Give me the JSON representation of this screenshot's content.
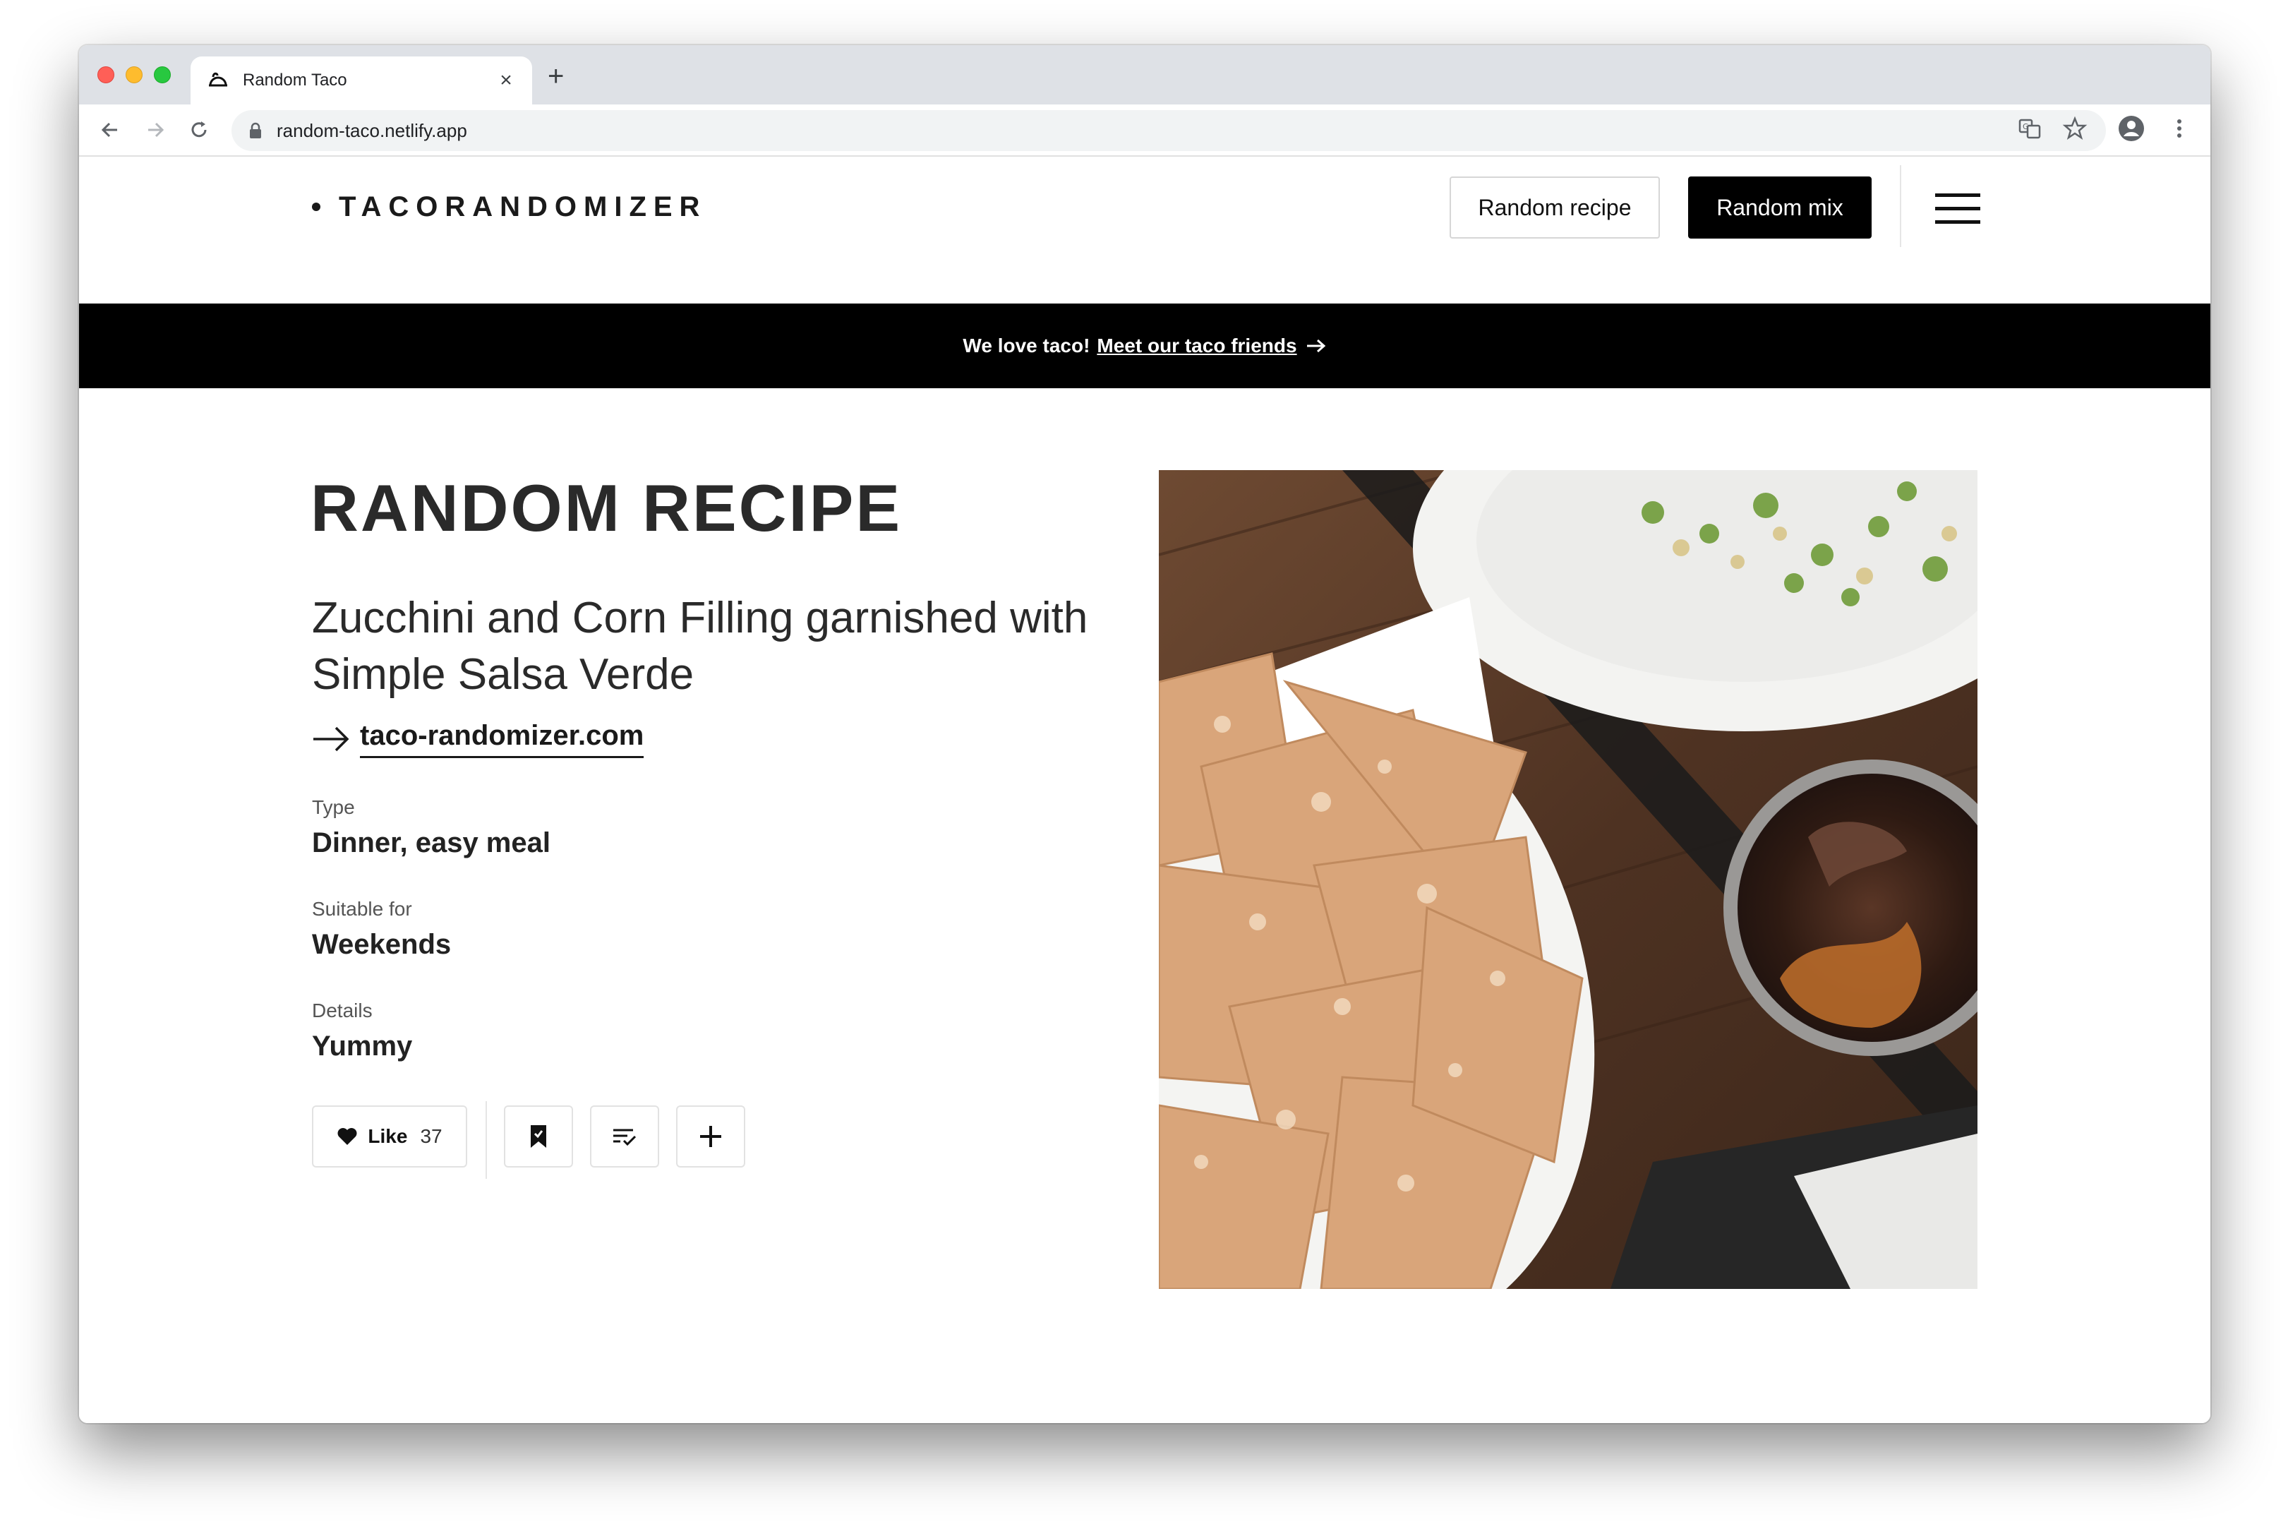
{
  "browser": {
    "tab_title": "Random Taco",
    "url": "random-taco.netlify.app"
  },
  "header": {
    "logo": "TACORANDOMIZER",
    "random_recipe_label": "Random recipe",
    "random_mix_label": "Random mix"
  },
  "banner": {
    "text": "We love taco!",
    "link_text": "Meet our taco friends"
  },
  "recipe": {
    "heading": "RANDOM RECIPE",
    "name": "Zucchini and Corn Filling garnished with Simple Salsa Verde",
    "source": "taco-randomizer.com",
    "meta": [
      {
        "label": "Type",
        "value": "Dinner, easy meal"
      },
      {
        "label": "Suitable for",
        "value": "Weekends"
      },
      {
        "label": "Details",
        "value": "Yummy"
      }
    ]
  },
  "actions": {
    "like_label": "Like",
    "like_count": "37"
  },
  "colors": {
    "accent": "#000000",
    "banner_bg": "#000000",
    "text": "#2a2a2a"
  }
}
